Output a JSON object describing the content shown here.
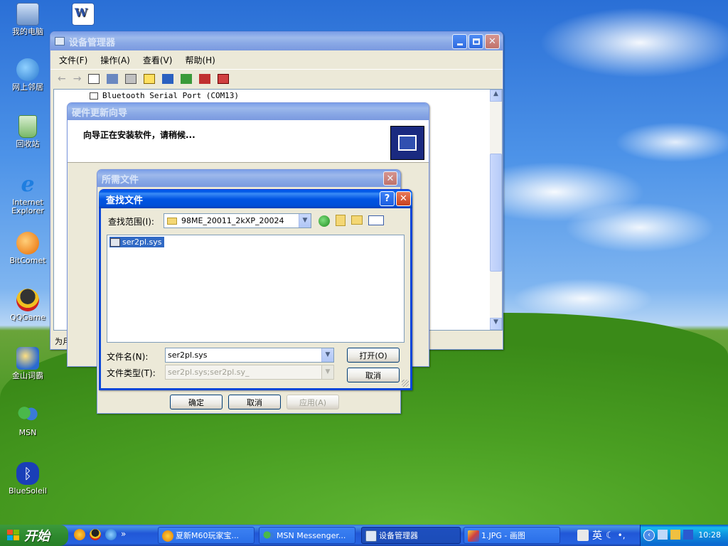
{
  "desktop": {
    "icons": [
      {
        "label": "我的电脑",
        "name": "my-computer-icon"
      },
      {
        "label": "网上邻居",
        "name": "network-places-icon"
      },
      {
        "label": "回收站",
        "name": "recycle-bin-icon"
      },
      {
        "label": "Internet Explorer",
        "name": "internet-explorer-icon"
      },
      {
        "label": "BitComet",
        "name": "bitcomet-icon"
      },
      {
        "label": "QQGame",
        "name": "qqgame-icon"
      },
      {
        "label": "金山词霸",
        "name": "kingsoft-dict-icon"
      },
      {
        "label": "MSN",
        "name": "msn-icon"
      },
      {
        "label": "BlueSoleil",
        "name": "bluesoleil-icon"
      }
    ]
  },
  "device_manager": {
    "title": "设备管理器",
    "menu": [
      "文件(F)",
      "操作(A)",
      "查看(V)",
      "帮助(H)"
    ],
    "tree_item": "Bluetooth Serial Port (COM13)",
    "status_prefix": "为月"
  },
  "hw_wizard": {
    "title": "硬件更新向导",
    "message": "向导正在安装软件，请稍候..."
  },
  "files_needed": {
    "title": "所需文件",
    "ok": "确定",
    "cancel": "取消",
    "apply": "应用(A)"
  },
  "find_file": {
    "title": "查找文件",
    "look_in_label": "查找范围(I):",
    "look_in_value": "98ME_20011_2kXP_20024",
    "files": [
      "ser2pl.sys"
    ],
    "filename_label": "文件名(N):",
    "filename_value": "ser2pl.sys",
    "filetype_label": "文件类型(T):",
    "filetype_value": "ser2pl.sys;ser2pl.sy_",
    "open_button": "打开(O)",
    "cancel_button": "取消",
    "help_glyph": "?",
    "close_glyph": "✕"
  },
  "taskbar": {
    "start_label": "开始",
    "more_glyph": "»",
    "tasks": [
      {
        "label": "夏新M60玩家宝...",
        "name": "task-m60"
      },
      {
        "label": "MSN Messenger...",
        "name": "task-msn"
      },
      {
        "label": "设备管理器",
        "name": "task-device-manager"
      },
      {
        "label": "1.JPG - 画图",
        "name": "task-paint"
      }
    ],
    "ime_label": "英",
    "clock": "10:28"
  },
  "colors": {
    "xp_blue": "#0054e3",
    "window_face": "#ece9d8",
    "start_green": "#2f8a2f",
    "selection": "#316ac5"
  }
}
